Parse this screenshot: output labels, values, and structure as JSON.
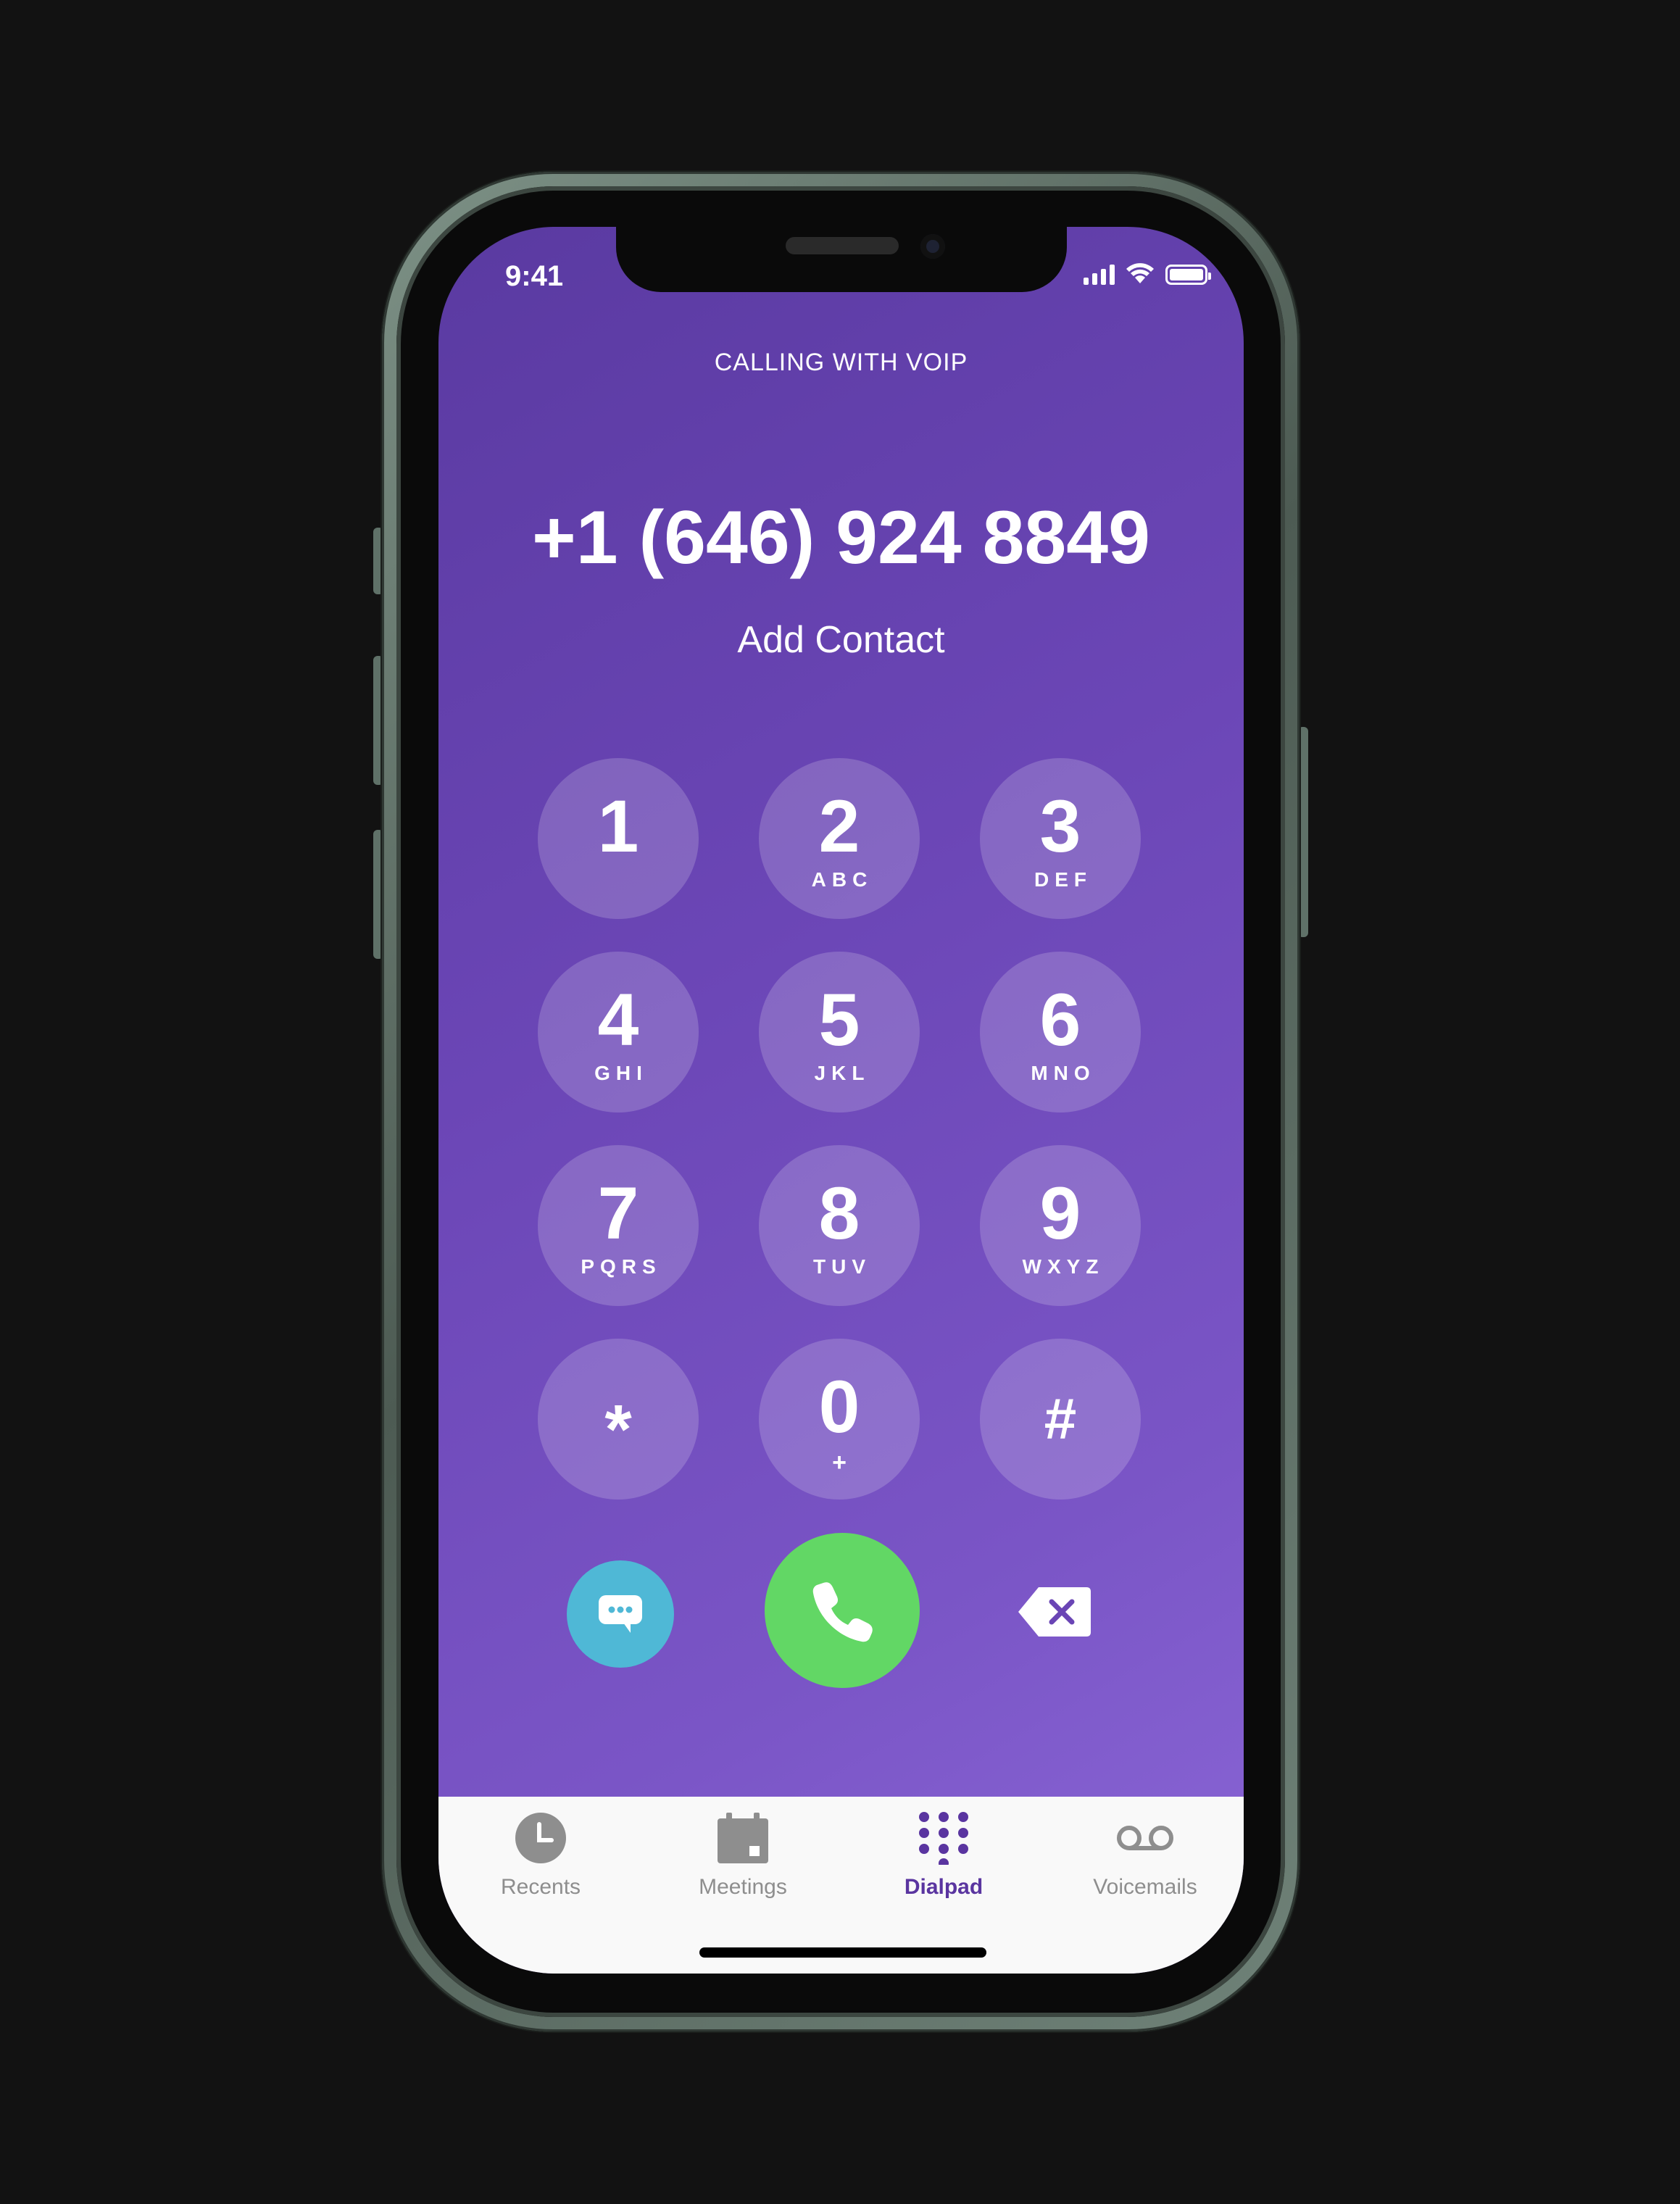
{
  "status_bar": {
    "time": "9:41"
  },
  "header": {
    "calling_label": "CALLING WITH VOIP",
    "phone_number": "+1 (646) 924 8849",
    "add_contact": "Add Contact"
  },
  "keypad": {
    "keys": [
      {
        "digit": "1",
        "letters": ""
      },
      {
        "digit": "2",
        "letters": "ABC"
      },
      {
        "digit": "3",
        "letters": "DEF"
      },
      {
        "digit": "4",
        "letters": "GHI"
      },
      {
        "digit": "5",
        "letters": "JKL"
      },
      {
        "digit": "6",
        "letters": "MNO"
      },
      {
        "digit": "7",
        "letters": "PQRS"
      },
      {
        "digit": "8",
        "letters": "TUV"
      },
      {
        "digit": "9",
        "letters": "WXYZ"
      },
      {
        "digit": "*",
        "letters": ""
      },
      {
        "digit": "0",
        "letters": "+"
      },
      {
        "digit": "#",
        "letters": ""
      }
    ]
  },
  "actions": {
    "message_icon": "message-bubble-icon",
    "call_icon": "phone-icon",
    "delete_icon": "backspace-icon"
  },
  "tabbar": {
    "tabs": [
      {
        "label": "Recents",
        "icon": "clock-icon",
        "active": false
      },
      {
        "label": "Meetings",
        "icon": "calendar-icon",
        "active": false
      },
      {
        "label": "Dialpad",
        "icon": "dialpad-icon",
        "active": true
      },
      {
        "label": "Voicemails",
        "icon": "voicemail-icon",
        "active": false
      }
    ]
  },
  "colors": {
    "background": "#121212",
    "screen_gradient_start": "#5a3aa1",
    "screen_gradient_end": "#8a66d6",
    "call_button": "#62d765",
    "message_button": "#4fb8d6",
    "active_tab": "#5a35a0",
    "inactive_tab": "#8e8e8e"
  }
}
